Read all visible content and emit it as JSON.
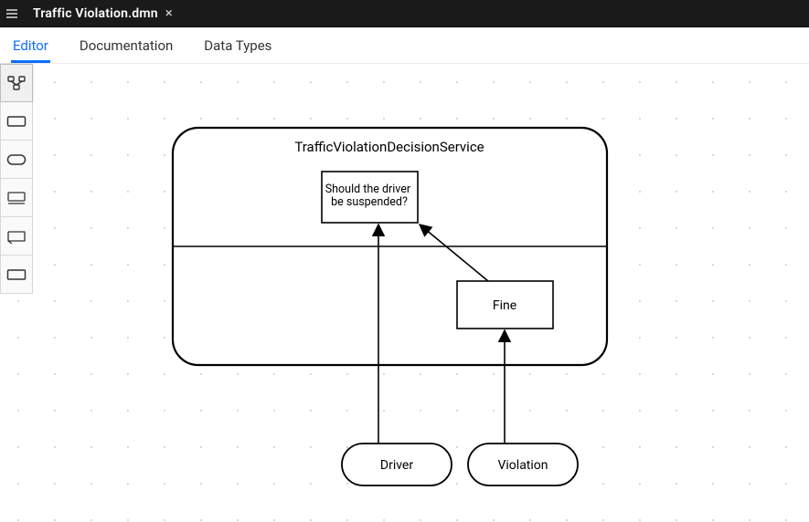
{
  "titlebar": {
    "filename": "Traffic Violation.dmn"
  },
  "tabs": {
    "editor": "Editor",
    "documentation": "Documentation",
    "datatypes": "Data Types",
    "active": "editor"
  },
  "toolbox": {
    "items": [
      {
        "name": "dmn-model-icon"
      },
      {
        "name": "decision-icon"
      },
      {
        "name": "knowledge-source-icon"
      },
      {
        "name": "bkm-icon"
      },
      {
        "name": "text-annotation-icon"
      },
      {
        "name": "input-data-icon"
      }
    ]
  },
  "diagram": {
    "service": {
      "label": "TrafficViolationDecisionService"
    },
    "decisions": {
      "suspend": {
        "label": "Should the driver be suspended?"
      },
      "fine": {
        "label": "Fine"
      }
    },
    "inputs": {
      "driver": {
        "label": "Driver"
      },
      "violation": {
        "label": "Violation"
      }
    }
  }
}
